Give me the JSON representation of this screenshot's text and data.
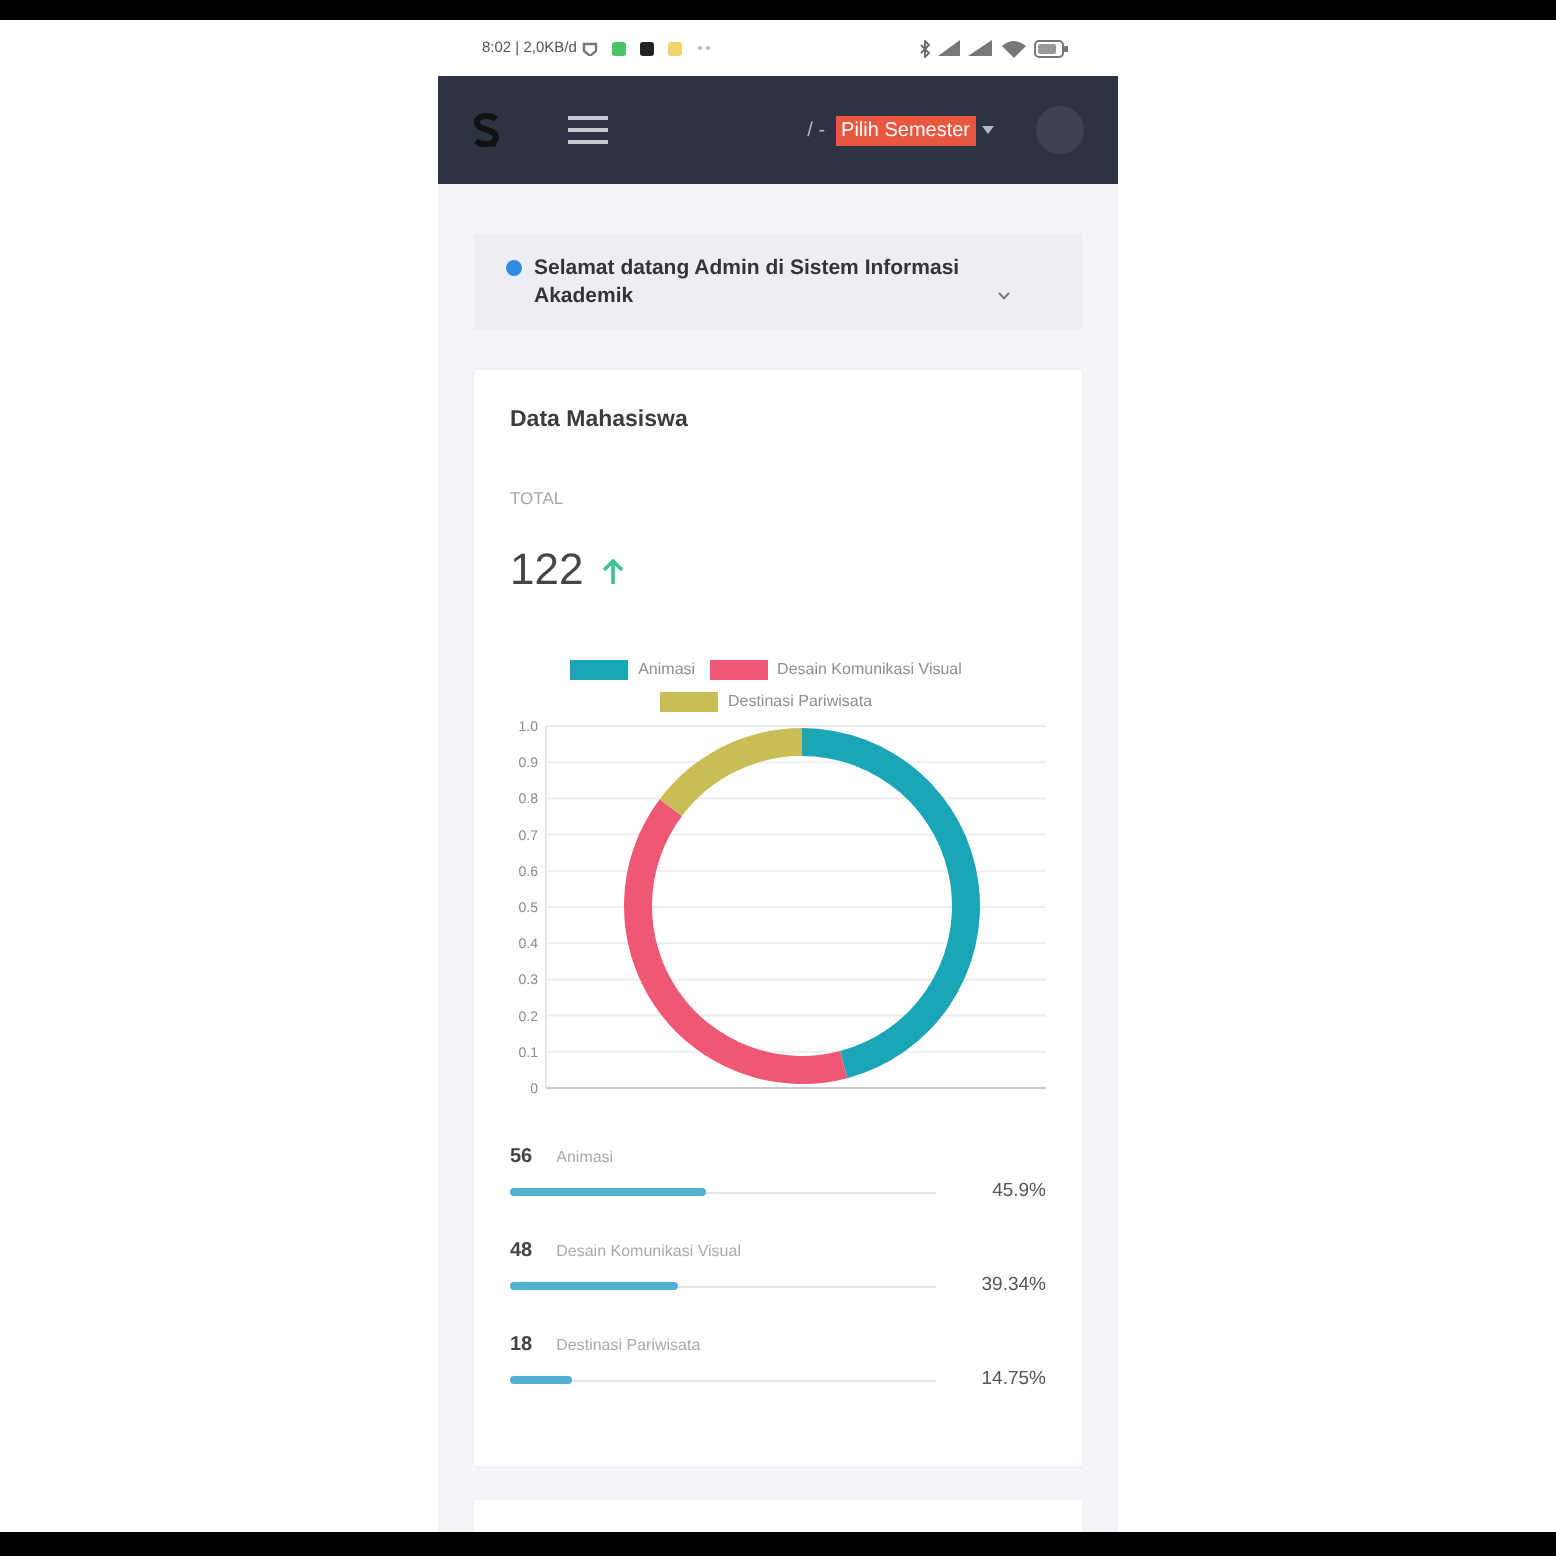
{
  "status_bar": {
    "info": "8:02 | 2,0KB/d"
  },
  "navbar": {
    "breadcrumb": "/ -",
    "semester_dropdown": {
      "label": "Pilih Semester"
    }
  },
  "welcome_banner": {
    "text": "Selamat datang Admin di Sistem Informasi Akademik"
  },
  "student_card": {
    "title": "Data Mahasiswa",
    "total_label": "TOTAL",
    "total_value": "122",
    "chart_data": {
      "type": "donut",
      "categories": [
        "Animasi",
        "Desain Komunikasi Visual",
        "Destinasi Pariwisata"
      ],
      "values": [
        45.9,
        39.34,
        14.75
      ],
      "legend": "top"
    },
    "chart_legend": [
      {
        "color": "#1ba6b8"
      },
      {
        "color": "#ef5874"
      },
      {
        "color": "#c9bd58"
      }
    ],
    "chart_axis_labels": [
      "1.0",
      "0.9",
      "0.8",
      "0.7",
      "0.6",
      "0.5",
      "0.4",
      "0.3",
      "0.2",
      "0.1",
      "0"
    ],
    "programs": [
      {
        "count": "56",
        "name": "Animasi",
        "level": 0.459,
        "percent": "45.9%"
      },
      {
        "count": "48",
        "name": "Desain Komunikasi Visual",
        "level": 0.3934,
        "percent": "39.34%"
      },
      {
        "count": "18",
        "name": "Destinasi Pariwisata",
        "level": 0.1475,
        "percent": "14.75%"
      }
    ]
  }
}
